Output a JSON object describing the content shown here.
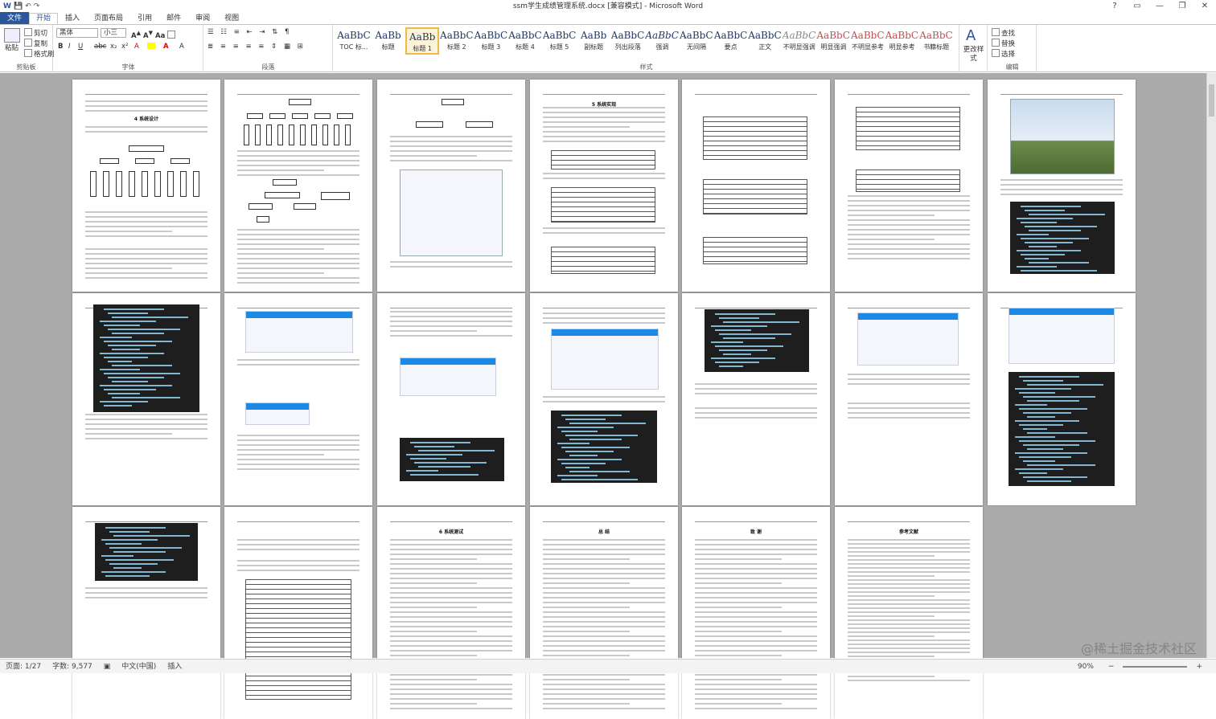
{
  "window": {
    "title": "ssm学生成绩管理系统.docx [兼容模式] - Microsoft Word",
    "qat": [
      "W",
      "💾",
      "↶",
      "↷"
    ],
    "controls": [
      "?",
      "▭",
      "—",
      "❐",
      "✕"
    ]
  },
  "tabs": [
    "文件",
    "开始",
    "插入",
    "页面布局",
    "引用",
    "邮件",
    "审阅",
    "视图"
  ],
  "ribbon": {
    "clipboard": {
      "paste": "粘贴",
      "cut": "剪切",
      "copy": "复制",
      "format_painter": "格式刷",
      "group": "剪贴板"
    },
    "font": {
      "name": "黑体",
      "size": "小三",
      "group": "字体"
    },
    "paragraph": {
      "group": "段落"
    },
    "styles": {
      "group": "样式",
      "items": [
        {
          "preview": "AaBbC",
          "label": "TOC 标..."
        },
        {
          "preview": "AaBb",
          "label": "标题"
        },
        {
          "preview": "AaBb",
          "label": "标题 1"
        },
        {
          "preview": "AaBbC",
          "label": "标题 2"
        },
        {
          "preview": "AaBbC",
          "label": "标题 3"
        },
        {
          "preview": "AaBbC",
          "label": "标题 4"
        },
        {
          "preview": "AaBbC",
          "label": "标题 5"
        },
        {
          "preview": "AaBb",
          "label": "副标题"
        },
        {
          "preview": "AaBbCcI",
          "label": "列出段落"
        },
        {
          "preview": "AaBbCcI",
          "label": "强调"
        },
        {
          "preview": "AaBbCcI",
          "label": "无间隔"
        },
        {
          "preview": "AaBbC",
          "label": "要点"
        },
        {
          "preview": "AaBbCcI",
          "label": "正文"
        },
        {
          "preview": "AaBbCcI",
          "label": "不明显强调"
        },
        {
          "preview": "AaBbCc",
          "label": "明显强调"
        },
        {
          "preview": "AaBbCc",
          "label": "不明显参考"
        },
        {
          "preview": "AaBbCc",
          "label": "明显参考"
        },
        {
          "preview": "AaBbCc",
          "label": "书籍标题"
        }
      ],
      "change": "更改样式"
    },
    "editing": {
      "find": "查找",
      "replace": "替换",
      "select": "选择",
      "group": "编辑"
    }
  },
  "pages": {
    "p1": {
      "heading": "4 系统设计"
    },
    "p4": {
      "heading": "5 系统实现"
    },
    "p17": {
      "heading": "6 系统测试"
    },
    "p18": {
      "heading": "总 结"
    },
    "p19": {
      "heading": "致 谢"
    },
    "p20": {
      "heading": "参考文献"
    }
  },
  "status": {
    "page": "页面: 1/27",
    "words": "字数: 9,577",
    "lang": "中文(中国)",
    "mode": "插入",
    "zoom": "90%"
  },
  "watermark": "@稀土掘金技术社区"
}
